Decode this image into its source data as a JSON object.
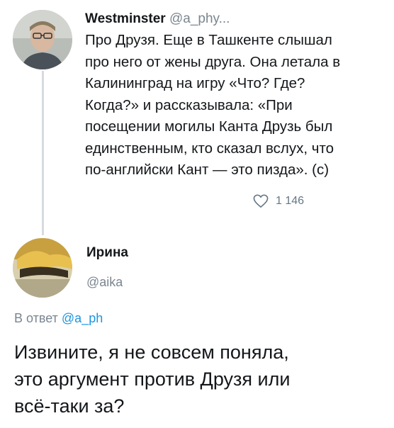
{
  "original_tweet": {
    "author_name": "Westminster",
    "author_handle": "@a_phy...",
    "text": "Про Друзя. Еще в Ташкенте слышал\nпро него от жены друга. Она летала в\nКалининград на игру «Что? Где?\nКогда?» и рассказывала: «При\nпосещении могилы Канта Друзь был\nединственным, кто сказал вслух, что\nпо-английски Кант — это пизда». (с)",
    "likes_count": "1 146",
    "like_icon": "heart-outline-icon"
  },
  "reply": {
    "author_name": "Ирина",
    "author_handle": "@aika",
    "in_reply_prefix": "В ответ",
    "in_reply_mention": "@a_ph",
    "text": "Извините, я не совсем поняла,\nэто аргумент против Друзя или\nвсё-таки за?"
  },
  "colors": {
    "handle_gray": "#7b8690",
    "mention_blue": "#1b95e0",
    "thread_line": "#d6dbe0"
  }
}
